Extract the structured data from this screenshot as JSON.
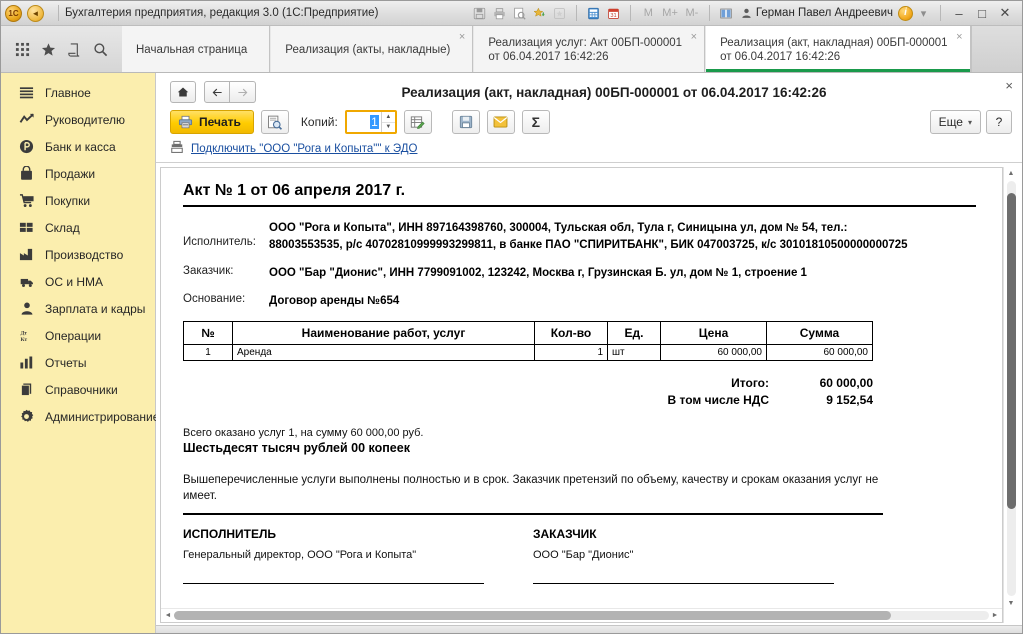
{
  "window": {
    "title": "Бухгалтерия предприятия, редакция 3.0  (1С:Предприятие)",
    "logo_icon": "1c-logo-icon",
    "back_icon": "back-circle-icon",
    "toolbar_icons": [
      "save-icon",
      "print-icon",
      "preview-icon",
      "add-favorite-icon",
      "favorites-icon",
      "calculator-icon",
      "calendar-icon"
    ],
    "memory": {
      "m": "M",
      "m_plus": "M+",
      "m_minus": "M-"
    },
    "split_icon": "split-window-icon",
    "user_icon": "user-icon",
    "user": "Герман Павел Андреевич",
    "info_icon": "info-icon",
    "dropdown_icon": "chevron-down-icon",
    "minimize": "–",
    "maximize": "□",
    "close": "✕"
  },
  "nav_icons": [
    {
      "name": "apps-grid-icon"
    },
    {
      "name": "favorites-star-icon"
    },
    {
      "name": "history-icon"
    },
    {
      "name": "search-icon"
    }
  ],
  "tabs": [
    {
      "label": "Начальная страница",
      "sub": "",
      "closable": false,
      "active": false
    },
    {
      "label": "Реализация (акты, накладные)",
      "sub": "",
      "closable": true,
      "active": false
    },
    {
      "label": "Реализация услуг: Акт 00БП-000001",
      "sub": "от 06.04.2017 16:42:26",
      "closable": true,
      "active": false
    },
    {
      "label": "Реализация (акт, накладная) 00БП-000001",
      "sub": "от 06.04.2017 16:42:26",
      "closable": true,
      "active": true
    }
  ],
  "sidebar": {
    "items": [
      {
        "label": "Главное",
        "icon": "menu-lines-icon"
      },
      {
        "label": "Руководителю",
        "icon": "trend-chart-icon"
      },
      {
        "label": "Банк и касса",
        "icon": "coin-icon"
      },
      {
        "label": "Продажи",
        "icon": "shopping-bag-icon"
      },
      {
        "label": "Покупки",
        "icon": "shopping-cart-icon"
      },
      {
        "label": "Склад",
        "icon": "warehouse-grid-icon"
      },
      {
        "label": "Производство",
        "icon": "factory-icon"
      },
      {
        "label": "ОС и НМА",
        "icon": "truck-icon"
      },
      {
        "label": "Зарплата и кадры",
        "icon": "person-icon"
      },
      {
        "label": "Операции",
        "icon": "debit-credit-icon"
      },
      {
        "label": "Отчеты",
        "icon": "bar-chart-icon"
      },
      {
        "label": "Справочники",
        "icon": "books-icon"
      },
      {
        "label": "Администрирование",
        "icon": "gear-icon"
      }
    ]
  },
  "form": {
    "home_icon": "home-icon",
    "back_icon": "arrow-left-icon",
    "forward_icon": "arrow-right-icon",
    "title": "Реализация (акт, накладная) 00БП-000001 от 06.04.2017 16:42:26",
    "close_icon": "close-icon"
  },
  "toolbar": {
    "print_label": "Печать",
    "print_icon": "printer-icon",
    "preview_icon": "print-preview-icon",
    "copies_label": "Копий:",
    "copies_value": "1",
    "edit_icon": "edit-table-icon",
    "save_icon": "save-icon",
    "mail_icon": "envelope-icon",
    "sum_icon": "Σ",
    "more_label": "Еще",
    "more_caret": "▾",
    "help_label": "?"
  },
  "edo": {
    "icon": "edo-stamp-icon",
    "link": "Подключить \"ООО \"Рога и Копыта\"\" к ЭДО"
  },
  "document": {
    "title": "Акт № 1 от 06 апреля 2017 г.",
    "executor_label": "Исполнитель:",
    "executor_value": "ООО \"Рога и Копыта\", ИНН 897164398760, 300004, Тульская обл, Тула г, Синицына ул, дом № 54, тел.: 88003553535, р/с 40702810999993299811, в банке ПАО \"СПИРИТБАНК\", БИК 047003725, к/с 30101810500000000725",
    "customer_label": "Заказчик:",
    "customer_value": "ООО \"Бар \"Дионис\", ИНН 7799091002, 123242, Москва г, Грузинская Б. ул, дом № 1, строение 1",
    "basis_label": "Основание:",
    "basis_value": "Договор аренды №654",
    "table": {
      "headers": [
        "№",
        "Наименование работ, услуг",
        "Кол-во",
        "Ед.",
        "Цена",
        "Сумма"
      ],
      "rows": [
        {
          "num": "1",
          "name": "Аренда",
          "qty": "1",
          "unit": "шт",
          "price": "60 000,00",
          "sum": "60 000,00"
        }
      ]
    },
    "totals": [
      {
        "label": "Итого:",
        "value": "60 000,00"
      },
      {
        "label": "В том числе НДС",
        "value": "9 152,54"
      }
    ],
    "summary_line": "Всего оказано услуг 1, на сумму 60 000,00 руб.",
    "summary_words": "Шестьдесят тысяч рублей 00 копеек",
    "clause": "Вышеперечисленные услуги выполнены полностью и в срок. Заказчик претензий по объему, качеству и срокам оказания услуг не имеет.",
    "signatures": [
      {
        "heading": "ИСПОЛНИТЕЛЬ",
        "value": "Генеральный директор, ООО \"Рога и Копыта\""
      },
      {
        "heading": "ЗАКАЗЧИК",
        "value": "ООО \"Бар \"Дионис\""
      }
    ]
  },
  "scroll": {
    "up_arrow": "▲",
    "down_arrow": "▼",
    "left_arrow": "◄",
    "right_arrow": "►"
  }
}
